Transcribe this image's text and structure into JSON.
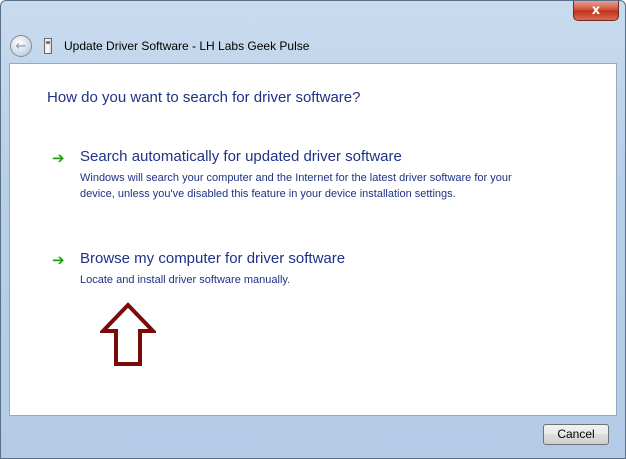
{
  "window": {
    "title": "Update Driver Software - LH Labs Geek Pulse",
    "close_glyph": "x"
  },
  "nav": {
    "back_glyph": "←"
  },
  "main": {
    "heading": "How do you want to search for driver software?",
    "options": [
      {
        "title": "Search automatically for updated driver software",
        "description": "Windows will search your computer and the Internet for the latest driver software for your device, unless you've disabled this feature in your device installation settings.",
        "icon": "green-arrow-icon"
      },
      {
        "title": "Browse my computer for driver software",
        "description": "Locate and install driver software manually.",
        "icon": "green-arrow-icon"
      }
    ],
    "annotation": {
      "icon": "up-arrow-outline-icon",
      "color": "#7b0a0a"
    }
  },
  "footer": {
    "cancel_label": "Cancel"
  },
  "colors": {
    "link_text": "#1e3287",
    "arrow_green": "#19a40a",
    "close_red": "#c0311c"
  }
}
